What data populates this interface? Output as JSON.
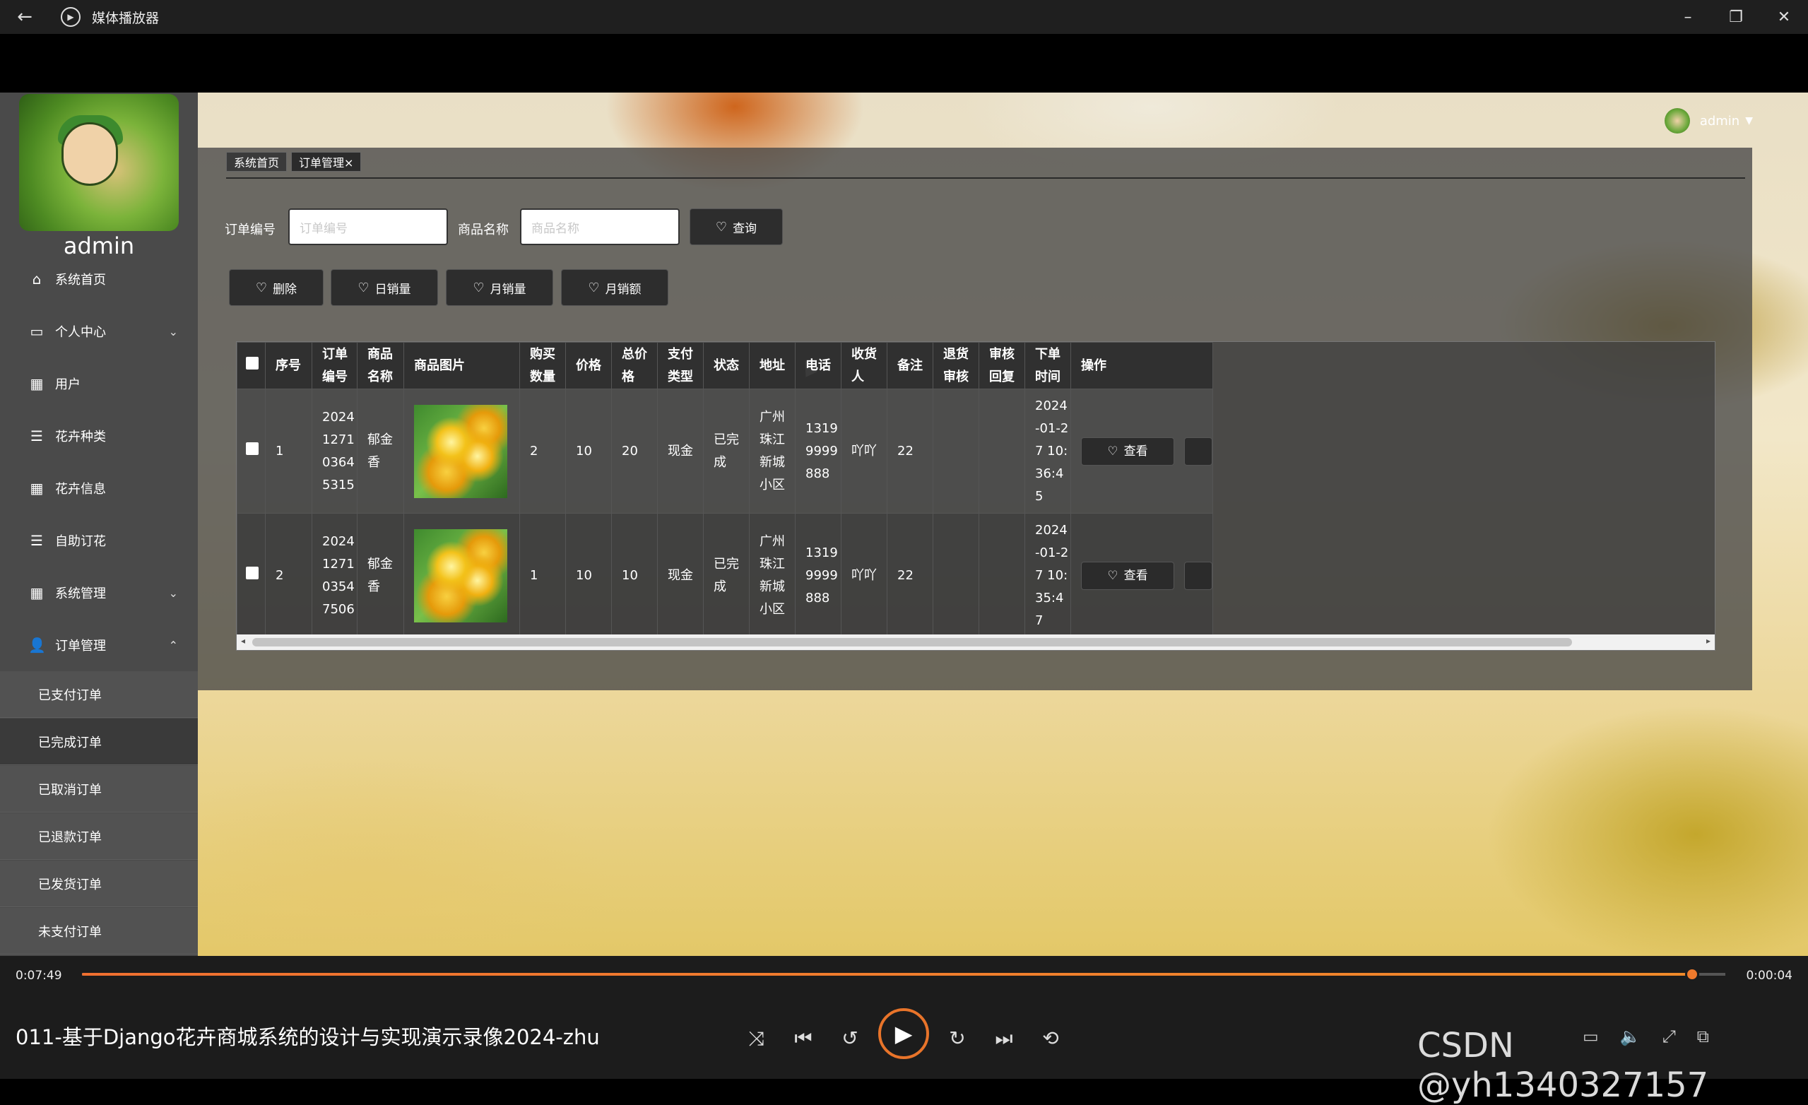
{
  "window": {
    "title": "媒体播放器"
  },
  "sidebar": {
    "username": "admin",
    "items": [
      {
        "label": "系统首页",
        "icon": "home-icon",
        "glyph": "⌂"
      },
      {
        "label": "个人中心",
        "icon": "card-icon",
        "glyph": "▭",
        "arrow": "⌄"
      },
      {
        "label": "用户",
        "icon": "grid-icon",
        "glyph": "▦"
      },
      {
        "label": "花卉种类",
        "icon": "list-icon",
        "glyph": "☰"
      },
      {
        "label": "花卉信息",
        "icon": "grid-icon",
        "glyph": "▦"
      },
      {
        "label": "自助订花",
        "icon": "list-icon",
        "glyph": "☰"
      },
      {
        "label": "系统管理",
        "icon": "table-icon",
        "glyph": "▦",
        "arrow": "⌄"
      },
      {
        "label": "订单管理",
        "icon": "person-icon",
        "glyph": "👤",
        "arrow": "⌃"
      }
    ],
    "subitems": [
      "已支付订单",
      "已完成订单",
      "已取消订单",
      "已退款订单",
      "已发货订单",
      "未支付订单"
    ],
    "active_subitem": "已完成订单"
  },
  "header": {
    "user": "admin",
    "caret": "▼"
  },
  "tabs": [
    {
      "label": "系统首页"
    },
    {
      "label": "订单管理×"
    }
  ],
  "search": {
    "order_no_label": "订单编号",
    "order_no_placeholder": "订单编号",
    "product_label": "商品名称",
    "product_placeholder": "商品名称",
    "query_button": "查询"
  },
  "actions": {
    "delete": "删除",
    "daily": "日销量",
    "monthly_volume": "月销量",
    "monthly_amount": "月销额"
  },
  "table": {
    "columns": [
      "",
      "序号",
      "订单编号",
      "商品名称",
      "商品图片",
      "购买数量",
      "价格",
      "总价格",
      "支付类型",
      "状态",
      "地址",
      "电话",
      "收货人",
      "备注",
      "退货审核",
      "审核回复",
      "下单时间",
      "操作"
    ],
    "rows": [
      {
        "no": "1",
        "order": "2024127103645315",
        "product": "郁金香",
        "qty": "2",
        "price": "10",
        "total": "20",
        "pay": "现金",
        "status": "已完成",
        "addr": "广州珠江新城小区",
        "phone": "13199999888",
        "receiver": "吖吖",
        "note": "22",
        "ret": "",
        "reply": "",
        "time": "2024-01-27 10:36:45",
        "view": "查看"
      },
      {
        "no": "2",
        "order": "2024127103547506",
        "product": "郁金香",
        "qty": "1",
        "price": "10",
        "total": "10",
        "pay": "现金",
        "status": "已完成",
        "addr": "广州珠江新城小区",
        "phone": "13199999888",
        "receiver": "吖吖",
        "note": "22",
        "ret": "",
        "reply": "",
        "time": "2024-01-27 10:35:47",
        "view": "查看"
      }
    ]
  },
  "player": {
    "current_time": "0:07:49",
    "remaining_time": "0:00:04",
    "progress": 0.98,
    "title": "011-基于Django花卉商城系统的设计与实现演示录像2024-zhu",
    "controls": {
      "shuffle": "⤨",
      "prev": "⏮",
      "back10": "↺",
      "play": "▶",
      "fwd30": "↻",
      "next": "⏭",
      "repeat": "⟲"
    }
  },
  "watermark": "CSDN @yh1340327157"
}
